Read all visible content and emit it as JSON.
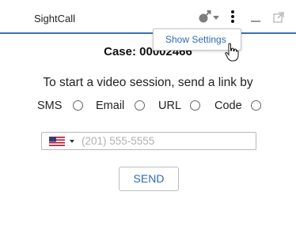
{
  "header": {
    "title": "SightCall",
    "status_icon": "gender-connected-icon",
    "menu_icon": "kebab-menu-icon",
    "minimize_icon": "minimize-icon",
    "popout_icon": "popout-icon",
    "accent_color": "#3a6fb5"
  },
  "tooltip": {
    "label": "Show Settings"
  },
  "case": {
    "text": "Case: 00002466"
  },
  "send_prompt": "To start a video session, send a link by",
  "options": [
    {
      "label": "SMS",
      "selected": false
    },
    {
      "label": "Email",
      "selected": false
    },
    {
      "label": "URL",
      "selected": false
    },
    {
      "label": "Code",
      "selected": false
    }
  ],
  "phone": {
    "country": "us-flag-icon",
    "placeholder": "(201) 555-5555",
    "value": ""
  },
  "send_button": {
    "label": "SEND"
  }
}
